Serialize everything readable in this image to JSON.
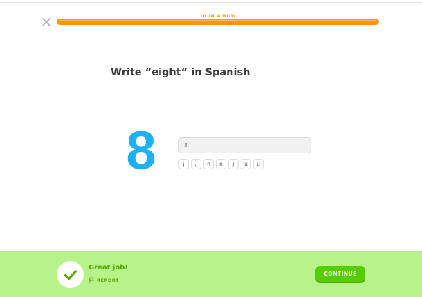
{
  "header": {
    "streak_label": "10 IN A ROW",
    "close_icon": "close-icon",
    "progress_fraction": 1.0,
    "progress_color": "#ff9600"
  },
  "question": {
    "prompt": "Write “eight“ in Spanish",
    "digit": "8",
    "digit_color": "#1cb0f6"
  },
  "answer": {
    "value": "8",
    "placeholder": ""
  },
  "special_chars": [
    "¡",
    "¿",
    "ñ",
    "ñ",
    "j",
    "ü",
    "ú"
  ],
  "footer": {
    "feedback": "Great job!",
    "report_label": "REPORT",
    "report_icon": "flag-icon",
    "check_icon": "checkmark-icon",
    "continue_label": "CONTINUE",
    "background": "#b8f28b",
    "accent": "#58cc02"
  }
}
